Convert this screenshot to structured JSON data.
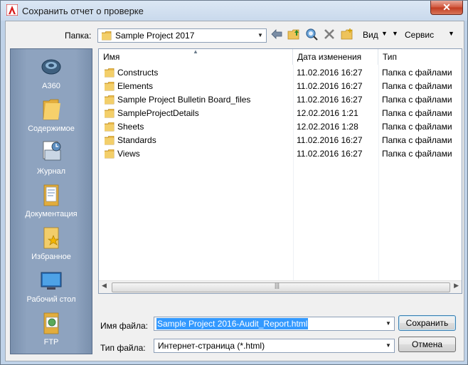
{
  "window": {
    "title": "Сохранить отчет о проверке",
    "close_glyph": "✕"
  },
  "toolbar": {
    "folder_label": "Папка:",
    "folder_value": "Sample Project 2017",
    "view_label": "Вид",
    "tools_label": "Сервис"
  },
  "sidebar": {
    "items": [
      {
        "label": "A360",
        "icon": "a360-icon"
      },
      {
        "label": "Содержимое",
        "icon": "folder-icon"
      },
      {
        "label": "Журнал",
        "icon": "history-icon"
      },
      {
        "label": "Документация",
        "icon": "documents-icon"
      },
      {
        "label": "Избранное",
        "icon": "favorites-icon"
      },
      {
        "label": "Рабочий стол",
        "icon": "desktop-icon"
      },
      {
        "label": "FTP",
        "icon": "ftp-icon"
      }
    ]
  },
  "file_list": {
    "columns": [
      "Имя",
      "Дата изменения",
      "Тип"
    ],
    "rows": [
      {
        "name": "Constructs",
        "date": "11.02.2016 16:27",
        "type": "Папка с файлами"
      },
      {
        "name": "Elements",
        "date": "11.02.2016 16:27",
        "type": "Папка с файлами"
      },
      {
        "name": "Sample Project Bulletin Board_files",
        "date": "11.02.2016 16:27",
        "type": "Папка с файлами"
      },
      {
        "name": "SampleProjectDetails",
        "date": "12.02.2016 1:21",
        "type": "Папка с файлами"
      },
      {
        "name": "Sheets",
        "date": "12.02.2016 1:28",
        "type": "Папка с файлами"
      },
      {
        "name": "Standards",
        "date": "11.02.2016 16:27",
        "type": "Папка с файлами"
      },
      {
        "name": "Views",
        "date": "11.02.2016 16:27",
        "type": "Папка с файлами"
      }
    ]
  },
  "form": {
    "filename_label": "Имя файла:",
    "filename_value": "Sample Project 2016-Audit_Report.html",
    "filetype_label": "Тип файла:",
    "filetype_value": "Интернет-страница (*.html)",
    "save_label": "Сохранить",
    "cancel_label": "Отмена"
  },
  "colors": {
    "sidebar": "#8ea3bf",
    "selection": "#3399ff",
    "close": "#c13b20"
  }
}
